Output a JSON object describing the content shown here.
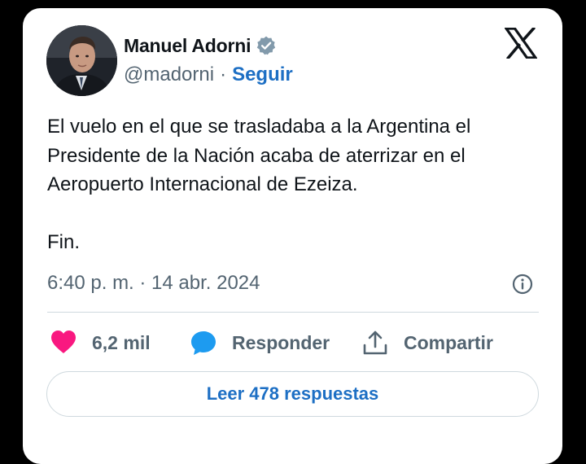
{
  "author": {
    "name": "Manuel Adorni",
    "handle": "@madorni",
    "separator": "·",
    "follow_label": "Seguir",
    "verified": true,
    "avatar_icon": "profile-photo"
  },
  "tweet": {
    "text": "El vuelo en el que se trasladaba a la Argentina el\nPresidente de la Nación acaba de aterrizar en el\nAeropuerto Internacional de Ezeiza.\n\nFin.",
    "timestamp": "6:40 p. m. · 14 abr. 2024"
  },
  "actions": {
    "like_count": "6,2 mil",
    "reply_label": "Responder",
    "share_label": "Compartir"
  },
  "replies_button": "Leer 478 respuestas",
  "colors": {
    "like": "#f91880",
    "reply": "#1d9bf0",
    "link": "#1d6fc4",
    "text_secondary": "#536471"
  }
}
